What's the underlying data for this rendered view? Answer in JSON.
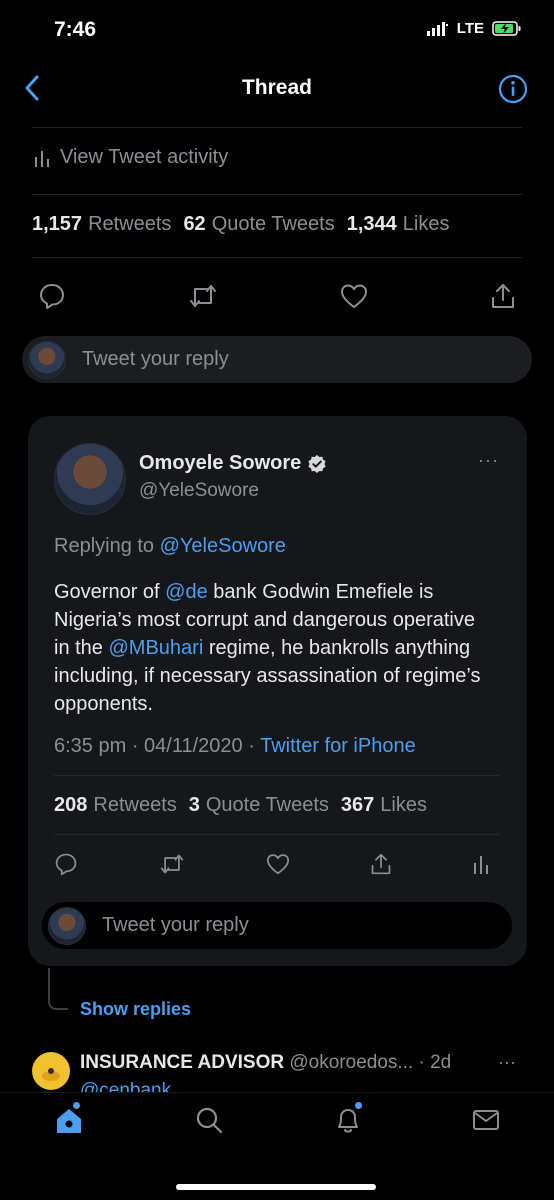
{
  "status_bar": {
    "time": "7:46",
    "network": "LTE"
  },
  "nav": {
    "title": "Thread"
  },
  "activity": {
    "label": "View Tweet activity"
  },
  "main_stats": [
    {
      "count": "1,157",
      "label": "Retweets"
    },
    {
      "count": "62",
      "label": "Quote Tweets"
    },
    {
      "count": "1,344",
      "label": "Likes"
    }
  ],
  "reply_top": {
    "placeholder": "Tweet your reply"
  },
  "quoted_tweet": {
    "author_name": "Omoyele Sowore",
    "author_handle": "@YeleSowore",
    "more": "···",
    "replying_prefix": "Replying to ",
    "replying_handle": "@YeleSowore",
    "body": {
      "p1": "Governor of ",
      "m1": "@de",
      "p2": " bank Godwin Emefiele is Nigeria’s most corrupt and dangerous operative in the ",
      "m2": "@MBuhari",
      "p3": " regime, he bankrolls anything including,  if necessary assassination of regime’s opponents."
    },
    "timestamp": "6:35 pm · 04/11/2020 · ",
    "source": "Twitter for iPhone",
    "stats": [
      {
        "count": "208",
        "label": "Retweets"
      },
      {
        "count": "3",
        "label": "Quote Tweets"
      },
      {
        "count": "367",
        "label": "Likes"
      }
    ],
    "reply_placeholder": "Tweet your reply"
  },
  "show_replies": "Show replies",
  "next_tweet": {
    "author_name": "INSURANCE ADVISOR",
    "author_handle": "@okoroedos...",
    "time": " · 2d",
    "more": "···",
    "mention": "@cenbank"
  },
  "colors": {
    "accent": "#4a9ff0",
    "background": "#000000",
    "card": "#15171a"
  },
  "icons": [
    "back-chevron-icon",
    "info-icon",
    "bar-chart-icon",
    "reply-icon",
    "retweet-icon",
    "like-icon",
    "share-icon",
    "verified-icon",
    "home-icon",
    "search-icon",
    "notifications-icon",
    "messages-icon"
  ]
}
